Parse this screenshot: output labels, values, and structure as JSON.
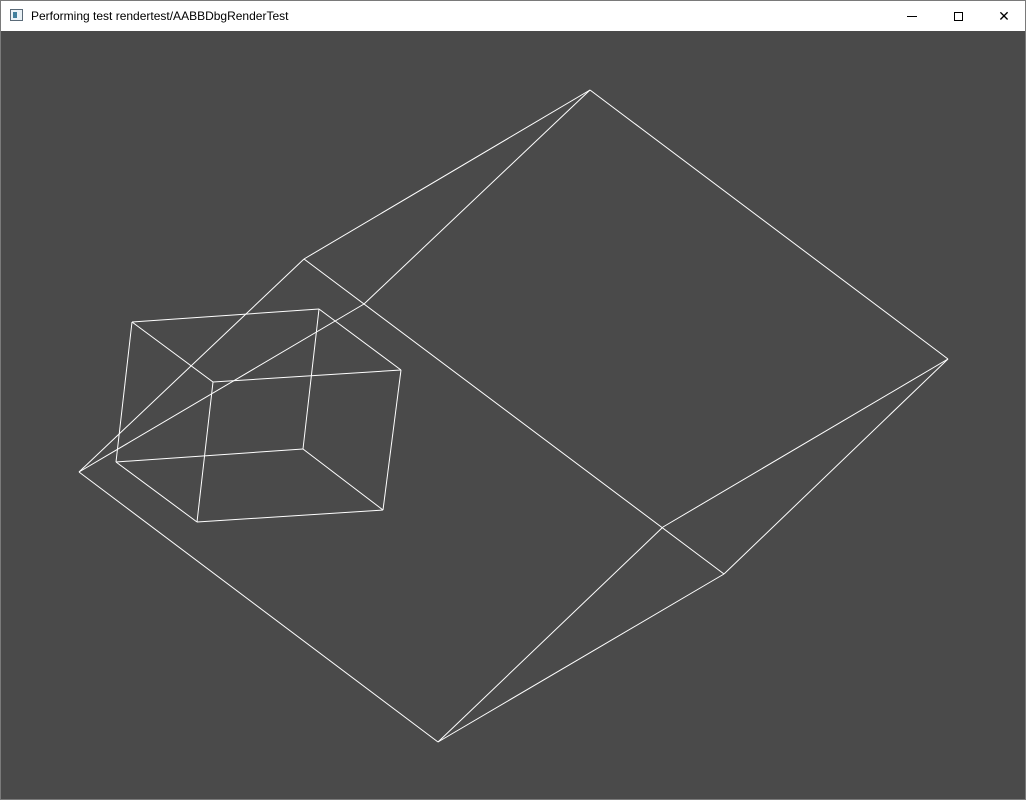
{
  "window": {
    "title": "Performing test rendertest/AABBDbgRenderTest",
    "controls": {
      "minimize": "minimize",
      "maximize": "maximize",
      "close": "close"
    }
  },
  "scene": {
    "background_color": "#4a4a4a",
    "line_color": "#ffffff"
  }
}
